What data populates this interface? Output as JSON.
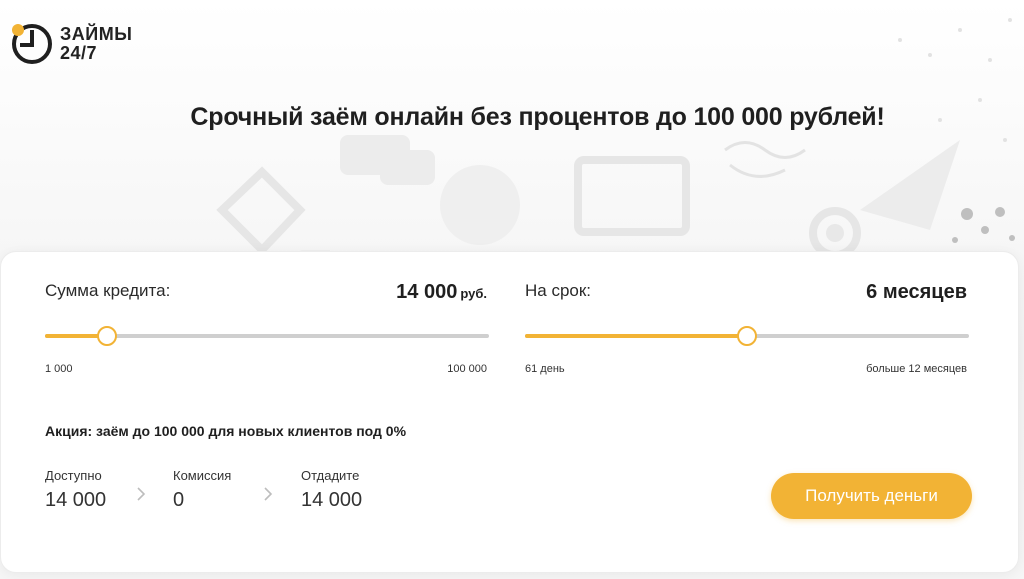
{
  "brand": {
    "line1": "ЗАЙМЫ",
    "line2": "24/7",
    "accent": "#f2b335"
  },
  "headline": "Срочный заём онлайн без процентов до 100 000 рублей!",
  "amount": {
    "label": "Сумма кредита:",
    "value": "14 000",
    "unit": "руб.",
    "min_label": "1 000",
    "max_label": "100 000",
    "fraction": 0.14
  },
  "term": {
    "label": "На срок:",
    "value": "6 месяцев",
    "min_label": "61 день",
    "max_label": "больше 12 месяцев",
    "fraction": 0.5
  },
  "promo": "Акция: заём до 100 000 для новых клиентов под 0%",
  "summary": {
    "available_label": "Доступно",
    "available_value": "14 000",
    "commission_label": "Комиссия",
    "commission_value": "0",
    "repay_label": "Отдадите",
    "repay_value": "14 000"
  },
  "cta_label": "Получить деньги",
  "icons": [
    "clock-logo-icon",
    "chevron-right-icon"
  ]
}
